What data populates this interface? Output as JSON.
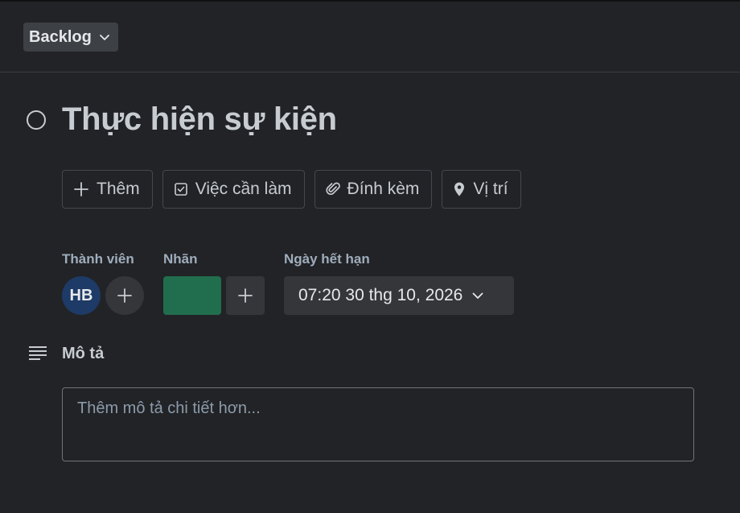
{
  "header": {
    "list_label": "Backlog"
  },
  "card": {
    "title": "Thực hiện sự kiện"
  },
  "actions": [
    {
      "label": "Thêm",
      "icon": "plus-icon"
    },
    {
      "label": "Việc cần làm",
      "icon": "checkbox-icon"
    },
    {
      "label": "Đính kèm",
      "icon": "paperclip-icon"
    },
    {
      "label": "Vị trí",
      "icon": "location-pin-icon"
    }
  ],
  "members": {
    "heading": "Thành viên",
    "avatar_initials": "HB",
    "avatar_color": "#1e3a66"
  },
  "labels": {
    "heading": "Nhãn",
    "chip_color": "#216e4e"
  },
  "due_date": {
    "heading": "Ngày hết hạn",
    "value": "07:20 30 thg 10, 2026"
  },
  "description": {
    "heading": "Mô tả",
    "placeholder": "Thêm mô tả chi tiết hơn..."
  }
}
